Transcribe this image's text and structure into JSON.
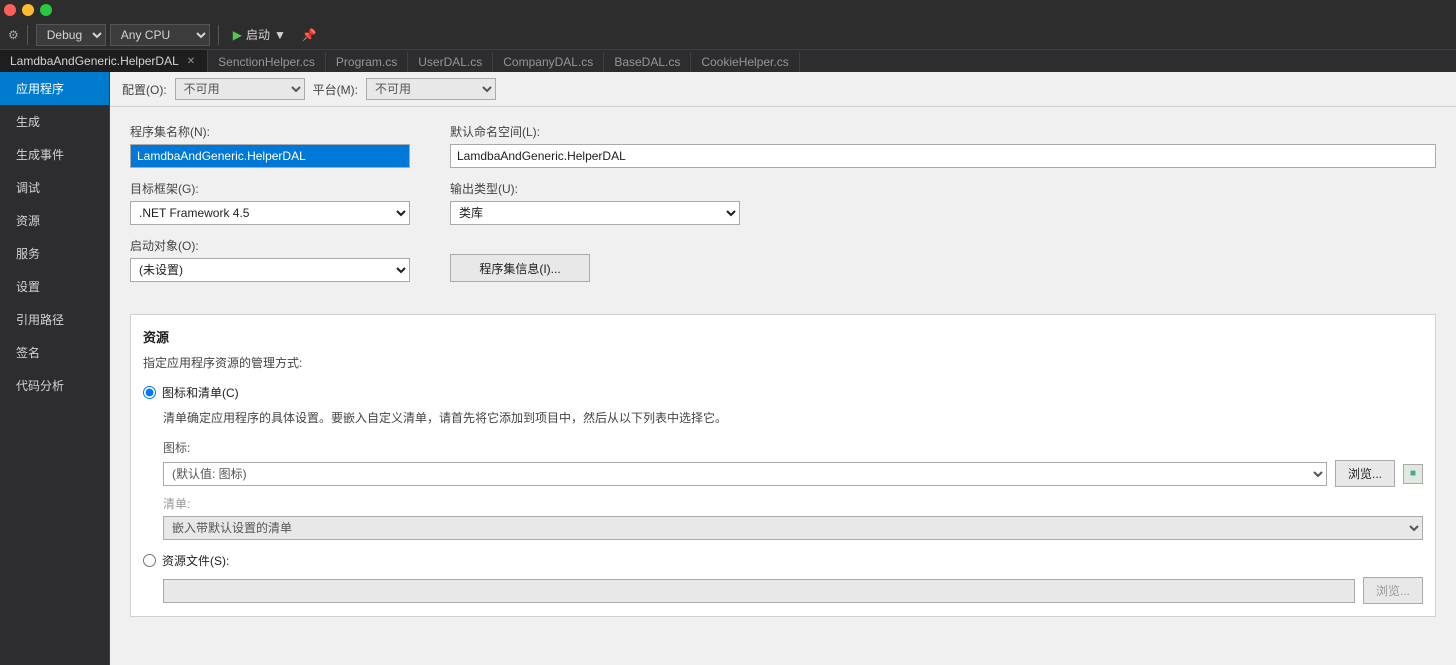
{
  "titlebar": {
    "buttons": [
      "close",
      "minimize",
      "maximize"
    ]
  },
  "toolbar": {
    "debug_label": "Debug",
    "cpu_label": "Any CPU",
    "start_label": "启动",
    "dropdown_arrow": "▼"
  },
  "tabs": [
    {
      "id": "lamdba",
      "label": "LamdbaAndGeneric.HelperDAL",
      "active": true,
      "closable": true
    },
    {
      "id": "senction",
      "label": "SenctionHelper.cs",
      "active": false,
      "closable": false
    },
    {
      "id": "program",
      "label": "Program.cs",
      "active": false,
      "closable": false
    },
    {
      "id": "user",
      "label": "UserDAL.cs",
      "active": false,
      "closable": false
    },
    {
      "id": "company",
      "label": "CompanyDAL.cs",
      "active": false,
      "closable": false
    },
    {
      "id": "base",
      "label": "BaseDAL.cs",
      "active": false,
      "closable": false
    },
    {
      "id": "cookie",
      "label": "CookieHelper.cs",
      "active": false,
      "closable": false
    }
  ],
  "sidebar": {
    "items": [
      {
        "id": "app",
        "label": "应用程序",
        "active": true
      },
      {
        "id": "build",
        "label": "生成",
        "active": false
      },
      {
        "id": "build-events",
        "label": "生成事件",
        "active": false
      },
      {
        "id": "debug",
        "label": "调试",
        "active": false
      },
      {
        "id": "resources",
        "label": "资源",
        "active": false
      },
      {
        "id": "services",
        "label": "服务",
        "active": false
      },
      {
        "id": "settings",
        "label": "设置",
        "active": false
      },
      {
        "id": "ref-paths",
        "label": "引用路径",
        "active": false
      },
      {
        "id": "signing",
        "label": "签名",
        "active": false
      },
      {
        "id": "code-analysis",
        "label": "代码分析",
        "active": false
      }
    ]
  },
  "config_bar": {
    "config_label": "配置(O):",
    "config_value": "不可用",
    "platform_label": "平台(M):",
    "platform_value": "不可用"
  },
  "form": {
    "assembly_name_label": "程序集名称(N):",
    "assembly_name_value": "LamdbaAndGeneric.HelperDAL",
    "default_namespace_label": "默认命名空间(L):",
    "default_namespace_value": "LamdbaAndGeneric.HelperDAL",
    "target_framework_label": "目标框架(G):",
    "target_framework_value": ".NET Framework 4.5",
    "output_type_label": "输出类型(U):",
    "output_type_value": "类库",
    "startup_object_label": "启动对象(O):",
    "startup_object_value": "(未设置)",
    "assembly_info_btn": "程序集信息(I)..."
  },
  "resources_section": {
    "title": "资源",
    "desc": "指定应用程序资源的管理方式:",
    "icon_menu_option_label": "图标和清单(C)",
    "icon_menu_desc": "清单确定应用程序的具体设置。要嵌入自定义清单，请首先将它添加到项目中，然后从以下列表中选择它。",
    "icon_label": "图标:",
    "icon_value": "(默认值: 图标)",
    "browse_btn": "浏览...",
    "menu_label": "清单:",
    "menu_value": "嵌入带默认设置的清单",
    "resource_file_option_label": "资源文件(S):",
    "resource_file_browse_btn": "浏览..."
  }
}
